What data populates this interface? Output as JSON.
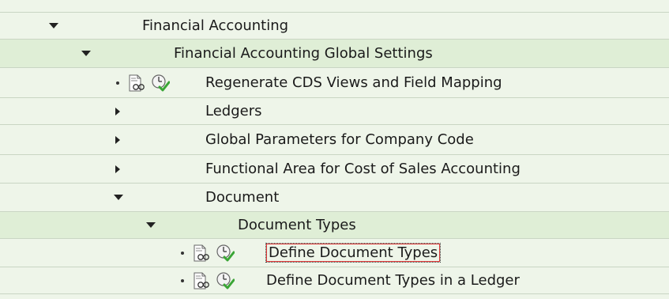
{
  "tree": {
    "items": [
      {
        "label": "Financial Accounting"
      },
      {
        "label": "Financial Accounting Global Settings"
      },
      {
        "label": "Regenerate CDS Views and Field Mapping"
      },
      {
        "label": "Ledgers"
      },
      {
        "label": "Global Parameters for Company Code"
      },
      {
        "label": "Functional Area for Cost of Sales Accounting"
      },
      {
        "label": "Document"
      },
      {
        "label": "Document Types"
      },
      {
        "label": "Define Document Types"
      },
      {
        "label": "Define Document Types in a Ledger"
      }
    ]
  },
  "colors": {
    "row_green_light": "#eef5e9",
    "row_green_dark": "#dfeed6",
    "selection_border": "#e23a3a"
  }
}
